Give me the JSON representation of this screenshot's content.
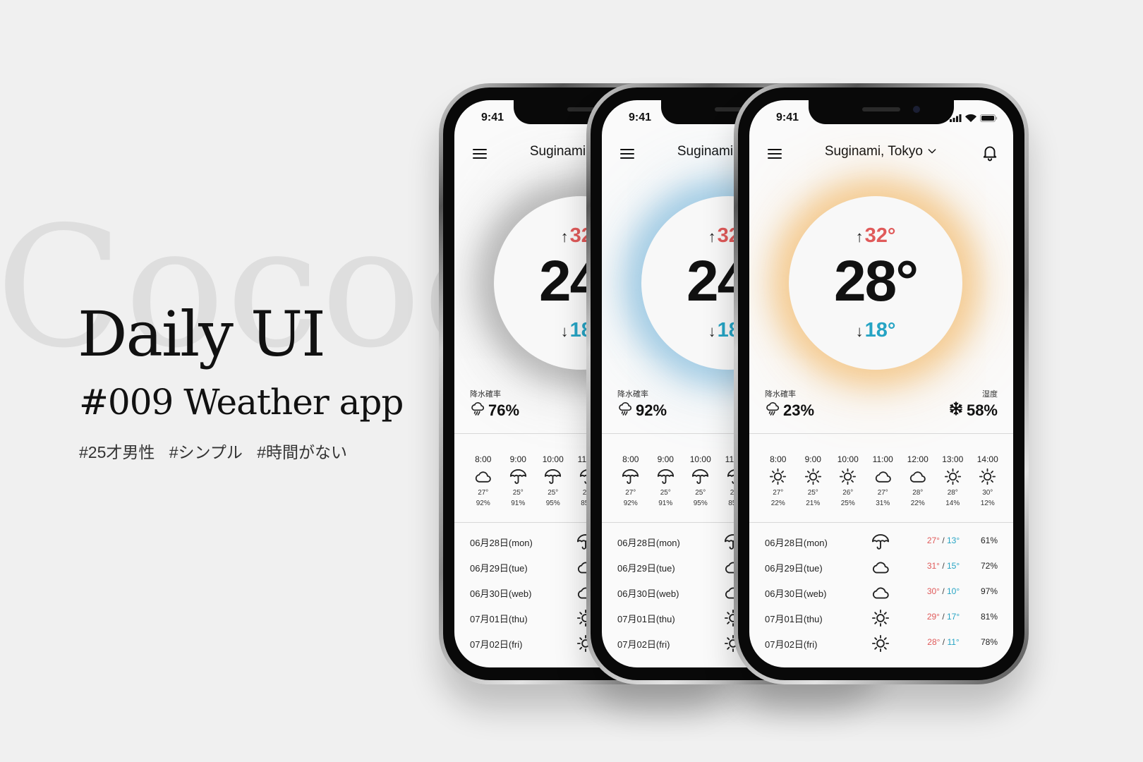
{
  "background_word": "Cocoda",
  "title": "Daily UI",
  "subtitle": "#009 Weather app",
  "tags": [
    "#25才男性",
    "#シンプル",
    "#時間がない"
  ],
  "colors": {
    "accent_high": "#e05a5a",
    "accent_low": "#26a4c4"
  },
  "phones": [
    {
      "id": "back",
      "glow_color": "#8e8e8e",
      "status_time": "9:41",
      "location": "Suginami, Tokyo",
      "temp_high": "32°",
      "temp_current": "24°",
      "temp_low": "18°",
      "precip_label": "降水確率",
      "precip_value": "76%",
      "hourly": [
        {
          "time": "8:00",
          "icon": "cloud-icon",
          "temp": "27°",
          "precip": "92%"
        },
        {
          "time": "9:00",
          "icon": "umbrella-icon",
          "temp": "25°",
          "precip": "91%"
        },
        {
          "time": "10:00",
          "icon": "umbrella-icon",
          "temp": "25°",
          "precip": "95%"
        },
        {
          "time": "11:00",
          "icon": "umbrella-icon",
          "temp": "26°",
          "precip": "85%"
        }
      ],
      "daily": [
        {
          "date": "06月28日(mon)",
          "icon": "umbrella-icon"
        },
        {
          "date": "06月29日(tue)",
          "icon": "cloud-icon"
        },
        {
          "date": "06月30日(web)",
          "icon": "cloud-icon"
        },
        {
          "date": "07月01日(thu)",
          "icon": "sun-icon"
        },
        {
          "date": "07月02日(fri)",
          "icon": "sun-icon"
        }
      ]
    },
    {
      "id": "middle",
      "glow_color": "#6cb0d8",
      "status_time": "9:41",
      "location": "Suginami, Tokyo",
      "temp_high": "32°",
      "temp_current": "24°",
      "temp_low": "18°",
      "precip_label": "降水確率",
      "precip_value": "92%",
      "hourly": [
        {
          "time": "8:00",
          "icon": "umbrella-icon",
          "temp": "27°",
          "precip": "92%"
        },
        {
          "time": "9:00",
          "icon": "umbrella-icon",
          "temp": "25°",
          "precip": "91%"
        },
        {
          "time": "10:00",
          "icon": "umbrella-icon",
          "temp": "25°",
          "precip": "95%"
        },
        {
          "time": "11:00",
          "icon": "umbrella-icon",
          "temp": "26°",
          "precip": "85%"
        }
      ],
      "daily": [
        {
          "date": "06月28日(mon)",
          "icon": "umbrella-icon"
        },
        {
          "date": "06月29日(tue)",
          "icon": "cloud-icon"
        },
        {
          "date": "06月30日(web)",
          "icon": "cloud-icon"
        },
        {
          "date": "07月01日(thu)",
          "icon": "sun-icon"
        },
        {
          "date": "07月02日(fri)",
          "icon": "sun-icon"
        }
      ]
    },
    {
      "id": "front",
      "glow_color": "#f2b055",
      "status_time": "9:41",
      "location": "Suginami, Tokyo",
      "temp_high": "32°",
      "temp_current": "28°",
      "temp_low": "18°",
      "precip_label": "降水確率",
      "precip_value": "23%",
      "humidity_label": "湿度",
      "humidity_value": "58%",
      "hourly": [
        {
          "time": "8:00",
          "icon": "sun-icon",
          "temp": "27°",
          "precip": "22%"
        },
        {
          "time": "9:00",
          "icon": "sun-icon",
          "temp": "25°",
          "precip": "21%"
        },
        {
          "time": "10:00",
          "icon": "sun-icon",
          "temp": "26°",
          "precip": "25%"
        },
        {
          "time": "11:00",
          "icon": "cloud-icon",
          "temp": "27°",
          "precip": "31%"
        },
        {
          "time": "12:00",
          "icon": "cloud-icon",
          "temp": "28°",
          "precip": "22%"
        },
        {
          "time": "13:00",
          "icon": "sun-icon",
          "temp": "28°",
          "precip": "14%"
        },
        {
          "time": "14:00",
          "icon": "sun-icon",
          "temp": "30°",
          "precip": "12%"
        }
      ],
      "daily": [
        {
          "date": "06月28日(mon)",
          "icon": "umbrella-icon",
          "high": "27°",
          "low": "13°",
          "humidity": "61%"
        },
        {
          "date": "06月29日(tue)",
          "icon": "cloud-icon",
          "high": "31°",
          "low": "15°",
          "humidity": "72%"
        },
        {
          "date": "06月30日(web)",
          "icon": "cloud-icon",
          "high": "30°",
          "low": "10°",
          "humidity": "97%"
        },
        {
          "date": "07月01日(thu)",
          "icon": "sun-icon",
          "high": "29°",
          "low": "17°",
          "humidity": "81%"
        },
        {
          "date": "07月02日(fri)",
          "icon": "sun-icon",
          "high": "28°",
          "low": "11°",
          "humidity": "78%"
        }
      ]
    }
  ]
}
